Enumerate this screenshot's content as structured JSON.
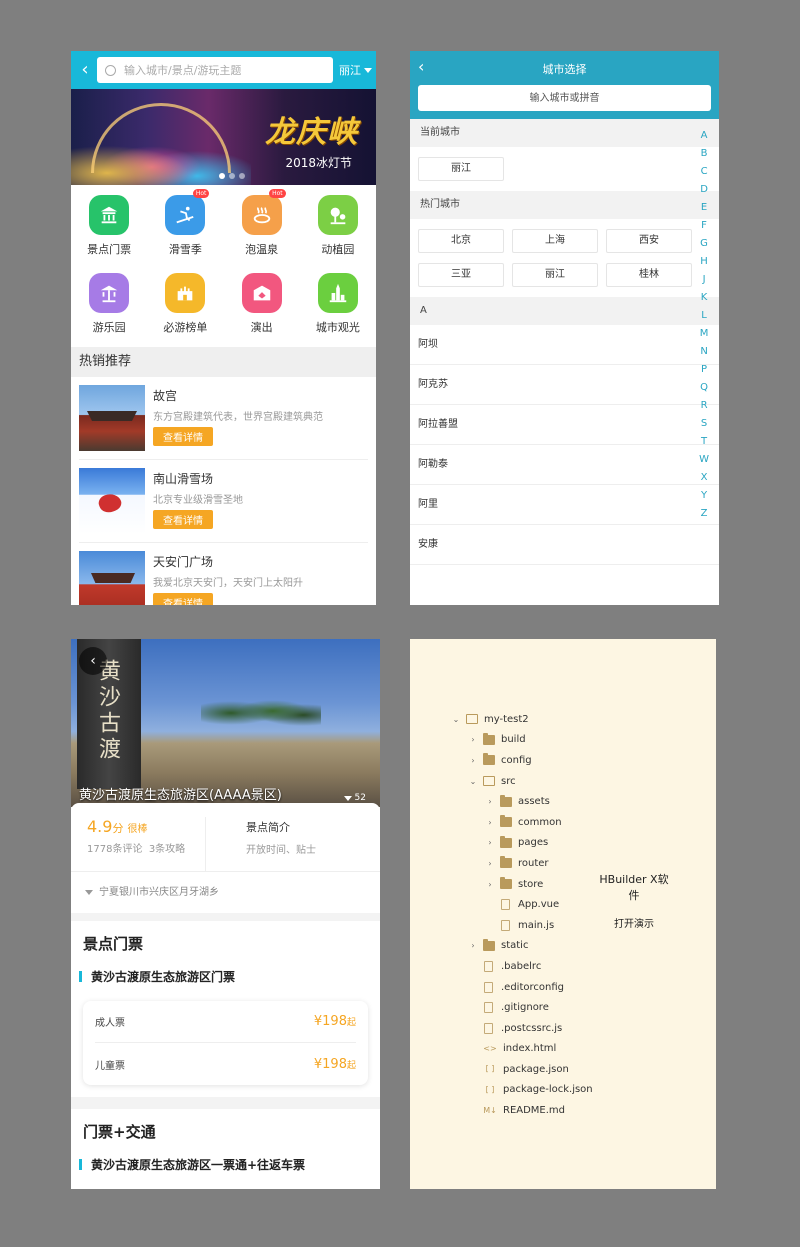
{
  "home": {
    "search_placeholder": "输入城市/景点/游玩主题",
    "city": "丽江",
    "banner_title": "龙庆峡",
    "banner_sub": "2018冰灯节",
    "categories": [
      {
        "label": "景点门票",
        "color": "#27c36a",
        "icon": "temple-icon",
        "hot": ""
      },
      {
        "label": "滑雪季",
        "color": "#3b9be8",
        "icon": "skiing-icon",
        "hot": "Hot"
      },
      {
        "label": "泡温泉",
        "color": "#f5a04a",
        "icon": "hot-spring-icon",
        "hot": "Hot"
      },
      {
        "label": "动植园",
        "color": "#7ccf45",
        "icon": "animal-plant-icon",
        "hot": ""
      },
      {
        "label": "游乐园",
        "color": "#a67be6",
        "icon": "amusement-park-icon",
        "hot": ""
      },
      {
        "label": "必游榜单",
        "color": "#f5b82a",
        "icon": "castle-icon",
        "hot": ""
      },
      {
        "label": "演出",
        "color": "#f2577f",
        "icon": "show-icon",
        "hot": ""
      },
      {
        "label": "城市观光",
        "color": "#6bcf3f",
        "icon": "city-tower-icon",
        "hot": ""
      }
    ],
    "section_title": "热销推荐",
    "items": [
      {
        "name": "故宫",
        "desc": "东方宫殿建筑代表，世界宫殿建筑典范",
        "btn": "查看详情"
      },
      {
        "name": "南山滑雪场",
        "desc": "北京专业级滑雪圣地",
        "btn": "查看详情"
      },
      {
        "name": "天安门广场",
        "desc": "我爱北京天安门，天安门上太阳升",
        "btn": "查看详情"
      }
    ]
  },
  "city": {
    "title": "城市选择",
    "search_placeholder": "输入城市或拼音",
    "current_label": "当前城市",
    "current_city": "丽江",
    "hot_label": "热门城市",
    "hot_cities": [
      "北京",
      "上海",
      "西安",
      "三亚",
      "丽江",
      "桂林"
    ],
    "group_letter": "A",
    "a_cities": [
      "阿坝",
      "阿克苏",
      "阿拉善盟",
      "阿勒泰",
      "阿里",
      "安康"
    ],
    "alphabet": [
      "A",
      "B",
      "C",
      "D",
      "E",
      "F",
      "G",
      "H",
      "J",
      "K",
      "L",
      "M",
      "N",
      "P",
      "Q",
      "R",
      "S",
      "T",
      "W",
      "X",
      "Y",
      "Z"
    ]
  },
  "detail": {
    "hero_stone_text": "黄沙古渡",
    "name": "黄沙古渡原生态旅游区(AAAA景区)",
    "photo_count": "52",
    "score": "4.9",
    "score_unit": "分",
    "score_word": "很棒",
    "reviews": "1778条评论",
    "guides": "3条攻略",
    "intro_title": "景点简介",
    "intro_sub": "开放时间、贴士",
    "address": "宁夏银川市兴庆区月牙湖乡",
    "ticket_section": "景点门票",
    "ticket_group": "黄沙古渡原生态旅游区门票",
    "tickets": [
      {
        "name": "成人票",
        "price": "¥198",
        "suffix": "起"
      },
      {
        "name": "儿童票",
        "price": "¥198",
        "suffix": "起"
      }
    ],
    "combo_section": "门票+交通",
    "combo_group": "黄沙古渡原生态旅游区一票通+往返车票"
  },
  "tree": {
    "rows": [
      {
        "depth": 0,
        "caret": "v",
        "icon": "folder-open",
        "name": "my-test2"
      },
      {
        "depth": 1,
        "caret": ">",
        "icon": "folder",
        "name": "build"
      },
      {
        "depth": 1,
        "caret": ">",
        "icon": "folder",
        "name": "config"
      },
      {
        "depth": 1,
        "caret": "v",
        "icon": "folder-open",
        "name": "src"
      },
      {
        "depth": 2,
        "caret": ">",
        "icon": "folder",
        "name": "assets"
      },
      {
        "depth": 2,
        "caret": ">",
        "icon": "folder",
        "name": "common"
      },
      {
        "depth": 2,
        "caret": ">",
        "icon": "folder",
        "name": "pages"
      },
      {
        "depth": 2,
        "caret": ">",
        "icon": "folder",
        "name": "router"
      },
      {
        "depth": 2,
        "caret": ">",
        "icon": "folder",
        "name": "store"
      },
      {
        "depth": 2,
        "caret": "",
        "icon": "vue",
        "name": "App.vue"
      },
      {
        "depth": 2,
        "caret": "",
        "icon": "file",
        "name": "main.js"
      },
      {
        "depth": 1,
        "caret": ">",
        "icon": "folder",
        "name": "static"
      },
      {
        "depth": 1,
        "caret": "",
        "icon": "file",
        "name": ".babelrc"
      },
      {
        "depth": 1,
        "caret": "",
        "icon": "file",
        "name": ".editorconfig"
      },
      {
        "depth": 1,
        "caret": "",
        "icon": "file",
        "name": ".gitignore"
      },
      {
        "depth": 1,
        "caret": "",
        "icon": "file",
        "name": ".postcssrc.js"
      },
      {
        "depth": 1,
        "caret": "",
        "icon": "html",
        "name": "index.html"
      },
      {
        "depth": 1,
        "caret": "",
        "icon": "json",
        "name": "package.json"
      },
      {
        "depth": 1,
        "caret": "",
        "icon": "json",
        "name": "package-lock.json"
      },
      {
        "depth": 1,
        "caret": "",
        "icon": "md",
        "name": "README.md"
      }
    ],
    "note_title": "HBuilder X软件",
    "note_sub": "打开演示"
  }
}
